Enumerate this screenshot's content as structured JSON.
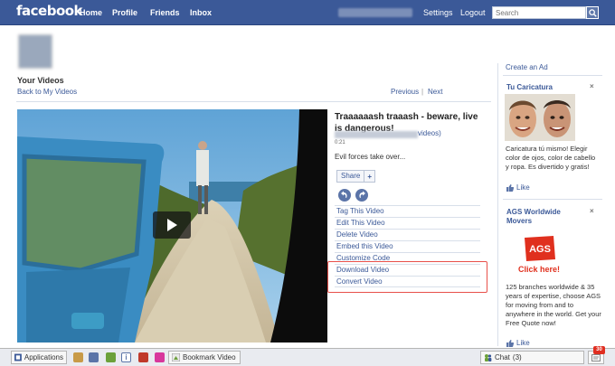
{
  "topbar": {
    "logo": "facebook",
    "nav": [
      "Home",
      "Profile",
      "Friends",
      "Inbox"
    ],
    "settings": "Settings",
    "logout": "Logout",
    "search_placeholder": "Search"
  },
  "page": {
    "title": "Your Videos",
    "back_link": "Back to My Videos",
    "prev": "Previous",
    "separator": "|",
    "next": "Next"
  },
  "video": {
    "title": "Traaaaaash traaash - beware, live is dangerous!",
    "videos_link": "videos)",
    "duration": "0:21",
    "description": "Evil forces take over...",
    "share_label": "Share",
    "share_plus": "+",
    "actions": [
      "Tag This Video",
      "Edit This Video",
      "Delete Video",
      "Embed this Video",
      "Customize Code",
      "Download Video",
      "Convert Video"
    ]
  },
  "ads": {
    "create_ad": "Create an Ad",
    "close": "×",
    "ad1": {
      "title": "Tu Caricatura",
      "text": "Caricatura tú mismo! Elegir color de ojos, color de cabello y ropa. Es divertido y gratis!",
      "like": "Like"
    },
    "ad2": {
      "title": "AGS Worldwide Movers",
      "logo": "AGS",
      "click": "Click here!",
      "text": "125 branches worldwide & 35 years of expertise, choose AGS for moving from and to anywhere in the world. Get your Free Quote now!",
      "like": "Like"
    }
  },
  "bottombar": {
    "applications": "Applications",
    "bookmark": "Bookmark Video",
    "chat": "Chat",
    "chat_count": "(3)",
    "notifications_count": "30"
  },
  "colors": {
    "brand_blue": "#3b5998",
    "highlight_red": "#e8504a",
    "ags_red": "#e0301e"
  }
}
